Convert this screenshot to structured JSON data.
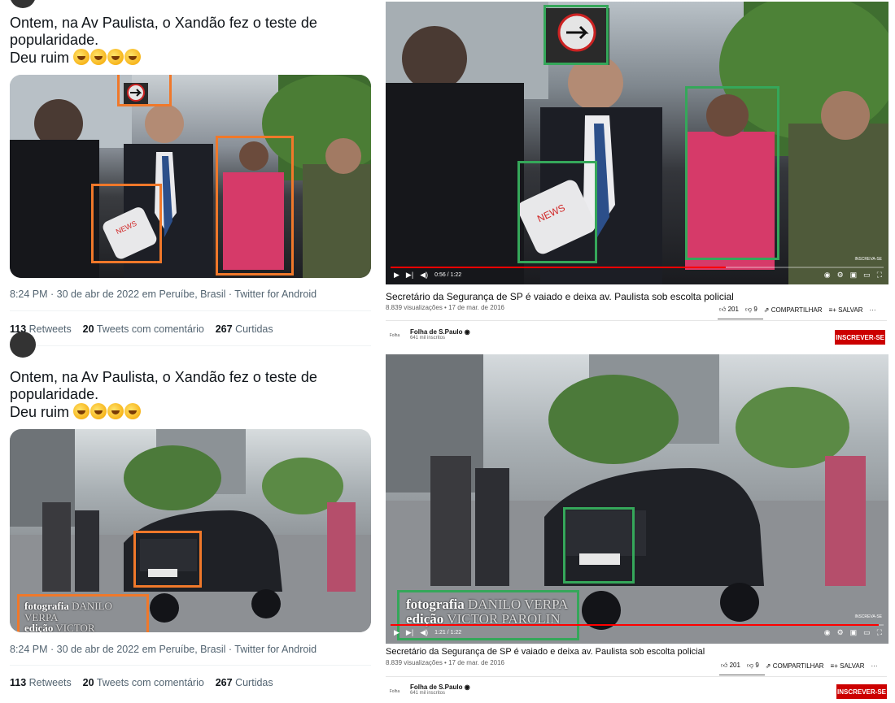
{
  "tweet": {
    "text_line1": "Ontem, na Av Paulista, o Xandão fez o teste de",
    "text_line2": "popularidade.",
    "text_line3": "Deu ruim",
    "meta": "8:24 PM · 30 de abr de 2022 em Peruíbe, Brasil · Twitter for Android",
    "retweets_count": "113",
    "retweets_label": "Retweets",
    "quotes_count": "20",
    "quotes_label": "Tweets com comentário",
    "likes_count": "267",
    "likes_label": "Curtidas"
  },
  "youtube": {
    "title": "Secretário da Segurança de SP é vaiado e deixa av. Paulista sob escolta policial",
    "views": "8.839 visualizações • 17 de mar. de 2016",
    "likes": "201",
    "dislikes": "9",
    "share": "COMPARTILHAR",
    "save": "SALVAR",
    "more": "···",
    "channel": "Folha de S.Paulo",
    "channel_logo": "Folha",
    "subscribers": "641 mil inscritos",
    "subscribe": "INSCREVER-SE",
    "time_top": "0:56 / 1:22",
    "time_bottom": "1:21 / 1:22",
    "watermark": "INSCREVA-SE"
  },
  "video_caption": {
    "photo_label": "fotografia",
    "photo_name": "DANILO VERPA",
    "edit_label": "edição",
    "edit_name": "VICTOR PAROLIN"
  },
  "colors": {
    "annotation_orange": "#f0782a",
    "annotation_green": "#35a75a",
    "youtube_red": "#cc0000",
    "progress_red": "#ff0000"
  },
  "progress": {
    "top_fraction": 0.68,
    "bottom_fraction": 0.99
  }
}
